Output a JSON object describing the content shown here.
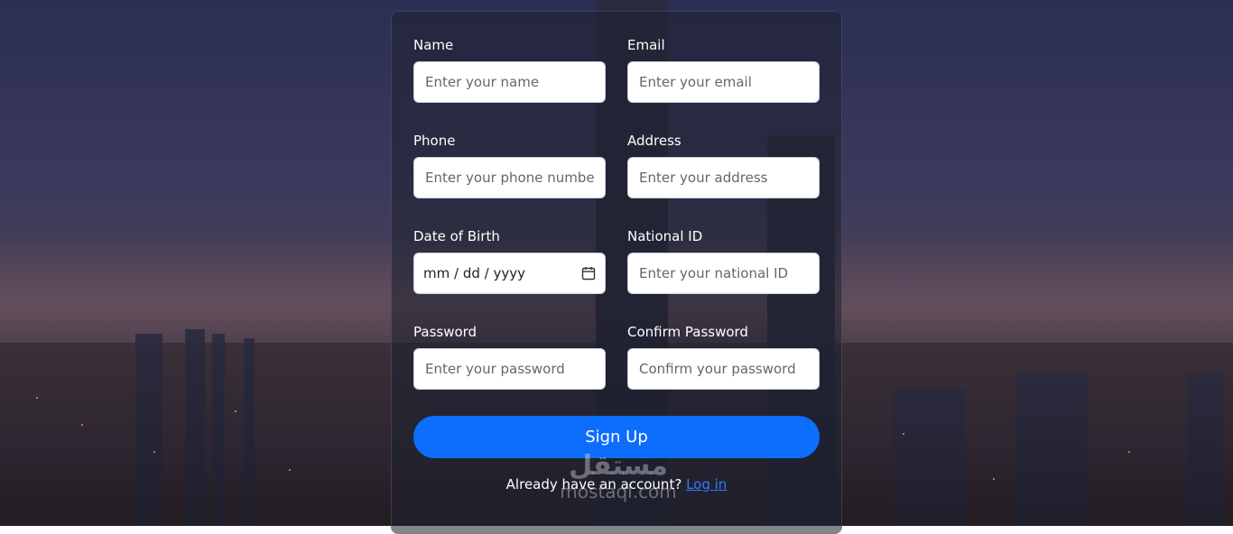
{
  "form": {
    "fields": [
      {
        "label": "Name",
        "placeholder": "Enter your name"
      },
      {
        "label": "Email",
        "placeholder": "Enter your email"
      },
      {
        "label": "Phone",
        "placeholder": "Enter your phone number"
      },
      {
        "label": "Address",
        "placeholder": "Enter your address"
      },
      {
        "label": "Date of Birth",
        "value": "mm / dd / yyyy"
      },
      {
        "label": "National ID",
        "placeholder": "Enter your national ID"
      },
      {
        "label": "Password",
        "placeholder": "Enter your password"
      },
      {
        "label": "Confirm Password",
        "placeholder": "Confirm your password"
      }
    ],
    "submit_label": "Sign Up",
    "footer_text": "Already have an account?",
    "login_link": "Log in"
  },
  "watermark": {
    "logo": "مستقل",
    "site": "mostaql.com"
  },
  "colors": {
    "accent": "#0d6efd",
    "link": "#2f7bff"
  }
}
